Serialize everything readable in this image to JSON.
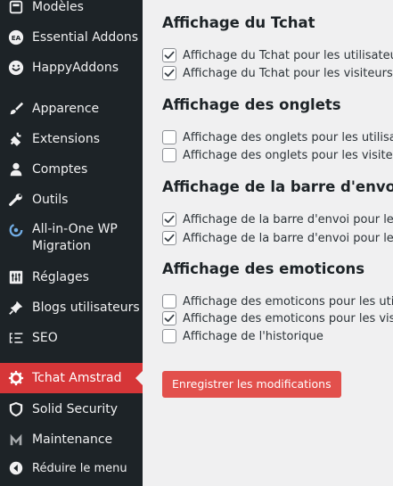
{
  "sidebar": {
    "items": [
      {
        "label": "Modèles",
        "icon": "templates-icon"
      },
      {
        "label": "Essential Addons",
        "icon": "essential-addons-icon"
      },
      {
        "label": "HappyAddons",
        "icon": "happyaddons-icon"
      },
      {
        "label": "Apparence",
        "icon": "paintbrush-icon"
      },
      {
        "label": "Extensions",
        "icon": "plugin-icon"
      },
      {
        "label": "Comptes",
        "icon": "user-icon"
      },
      {
        "label": "Outils",
        "icon": "wrench-icon"
      },
      {
        "label_line1": "All-in-One WP",
        "label_line2": "Migration",
        "icon": "migration-icon"
      },
      {
        "label": "Réglages",
        "icon": "settings-sliders-icon"
      },
      {
        "label": "Blogs utilisateurs",
        "icon": "pin-icon"
      },
      {
        "label": "SEO",
        "icon": "seo-icon"
      },
      {
        "label": "Tchat Amstrad",
        "icon": "gear-icon",
        "active": true
      },
      {
        "label": "Solid Security",
        "icon": "shield-icon"
      },
      {
        "label": "Maintenance",
        "icon": "maintenance-m-icon"
      },
      {
        "label": "Réduire le menu",
        "icon": "collapse-icon"
      }
    ],
    "colors": {
      "background": "#1d2327",
      "active": "#d63638",
      "text": "#f0f0f1"
    }
  },
  "main": {
    "sections": [
      {
        "title": "Affichage du Tchat",
        "options": [
          {
            "label": "Affichage du Tchat pour les utilisateurs",
            "checked": true
          },
          {
            "label": "Affichage du Tchat pour les visiteurs",
            "checked": true
          }
        ]
      },
      {
        "title": "Affichage des onglets",
        "options": [
          {
            "label": "Affichage des onglets pour les utilisateurs",
            "checked": false
          },
          {
            "label": "Affichage des onglets pour les visiteurs",
            "checked": false
          }
        ]
      },
      {
        "title": "Affichage de la barre d'envoi",
        "options": [
          {
            "label": "Affichage de la barre d'envoi pour les utilisateurs",
            "checked": true
          },
          {
            "label": "Affichage de la barre d'envoi pour les visiteurs",
            "checked": true
          }
        ]
      },
      {
        "title": "Affichage des emoticons",
        "options": [
          {
            "label": "Affichage des emoticons pour les utilisateurs",
            "checked": false
          },
          {
            "label": "Affichage des emoticons pour les visiteurs",
            "checked": true
          },
          {
            "label": "Affichage de l'historique",
            "checked": false
          }
        ]
      }
    ],
    "save_label": "Enregistrer les modifications",
    "colors": {
      "button": "#e2504c",
      "background": "#f0f0f1"
    }
  }
}
